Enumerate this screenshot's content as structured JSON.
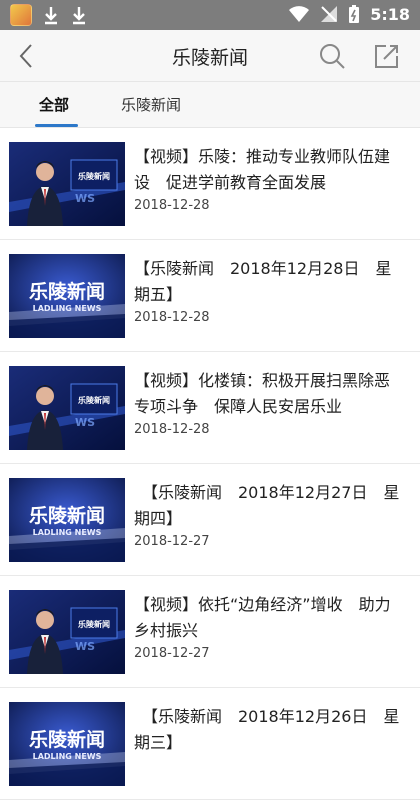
{
  "status_bar": {
    "time": "5:18"
  },
  "header": {
    "title": "乐陵新闻"
  },
  "tabs": [
    {
      "label": "全部"
    },
    {
      "label": "乐陵新闻"
    }
  ],
  "news": [
    {
      "thumb": "anchor",
      "title": "【视频】乐陵：推动专业教师队伍建设　促进学前教育全面发展",
      "date": "2018-12-28"
    },
    {
      "thumb": "logo",
      "title": "【乐陵新闻　2018年12月28日　星期五】",
      "date": "2018-12-28"
    },
    {
      "thumb": "anchor",
      "title": "【视频】化楼镇：积极开展扫黑除恶专项斗争　保障人民安居乐业",
      "date": "2018-12-28"
    },
    {
      "thumb": "logo",
      "title": "　【乐陵新闻　2018年12月27日　星期四】",
      "date": "2018-12-27"
    },
    {
      "thumb": "anchor",
      "title": "【视频】依托“边角经济”增收　助力乡村振兴",
      "date": "2018-12-27"
    },
    {
      "thumb": "logo",
      "title": "　【乐陵新闻　2018年12月26日　星期三】",
      "date": ""
    }
  ],
  "thumb_text": {
    "logo_cn": "乐陵新闻",
    "logo_en": "LADLING NEWS"
  }
}
